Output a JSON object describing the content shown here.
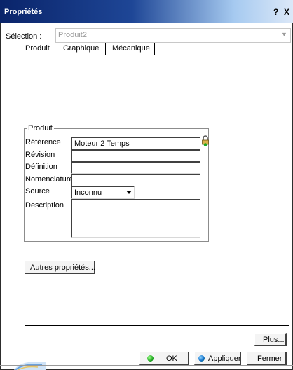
{
  "window": {
    "title": "Propriétés",
    "help_label": "?",
    "close_label": "X"
  },
  "selection": {
    "label": "Sélection :",
    "value": "Produit2"
  },
  "tabs": [
    {
      "label": "Produit"
    },
    {
      "label": "Graphique"
    },
    {
      "label": "Mécanique"
    }
  ],
  "group": {
    "legend": "Produit",
    "fields": {
      "reference": {
        "label": "Référence",
        "value": "Moteur 2 Temps"
      },
      "revision": {
        "label": "Révision",
        "value": ""
      },
      "definition": {
        "label": "Définition",
        "value": ""
      },
      "nomenclature": {
        "label": "Nomenclature",
        "value": ""
      },
      "source": {
        "label": "Source",
        "value": "Inconnu"
      },
      "description": {
        "label": "Description",
        "value": ""
      }
    }
  },
  "buttons": {
    "other_props": "Autres propriétés...",
    "more": "Plus...",
    "ok": "OK",
    "apply": "Appliquer",
    "close": "Fermer"
  },
  "colors": {
    "title_bar_start": "#0a246a",
    "ok_dot": "#129b15",
    "apply_dot": "#0f6cc8"
  },
  "icons": {
    "lock": "padlock-icon",
    "ok": "green-light-icon",
    "apply": "apply-icon"
  }
}
